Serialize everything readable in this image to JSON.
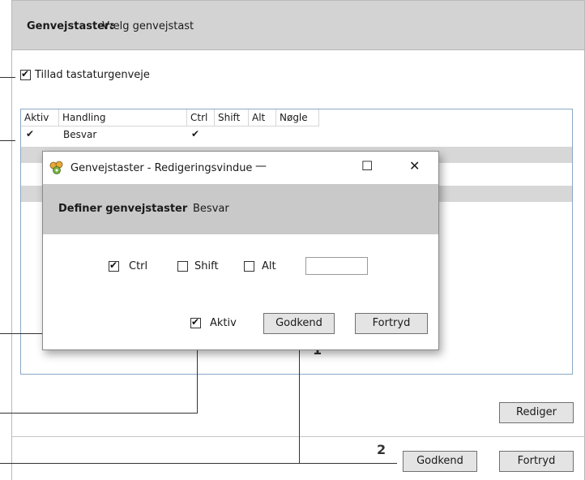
{
  "header": {
    "label": "Genvejstaster:",
    "value": "Vælg genvejstast"
  },
  "allow_shortcuts": {
    "label": "Tillad tastaturgenveje",
    "checked": true
  },
  "table": {
    "columns": [
      "Aktiv",
      "Handling",
      "Ctrl",
      "Shift",
      "Alt",
      "Nøgle"
    ],
    "rows": [
      {
        "aktiv": "✔",
        "handling": "Besvar",
        "ctrl": "✔",
        "shift": "",
        "alt": "",
        "key": ""
      }
    ]
  },
  "dialog": {
    "title": "Genvejstaster - Redigeringsvindue",
    "minimize": "—",
    "maximize": "☐",
    "close": "✕",
    "define_label": "Definer genvejstaster",
    "define_value": "Besvar",
    "ctrl_label": "Ctrl",
    "ctrl_checked": true,
    "shift_label": "Shift",
    "shift_checked": false,
    "alt_label": "Alt",
    "alt_checked": false,
    "key_value": "",
    "active_label": "Aktiv",
    "active_checked": true,
    "approve_label": "Godkend",
    "cancel_label": "Fortryd"
  },
  "buttons": {
    "edit": "Rediger",
    "approve": "Godkend",
    "cancel": "Fortryd"
  },
  "callout_numbers": {
    "one": "1",
    "two": "2"
  }
}
